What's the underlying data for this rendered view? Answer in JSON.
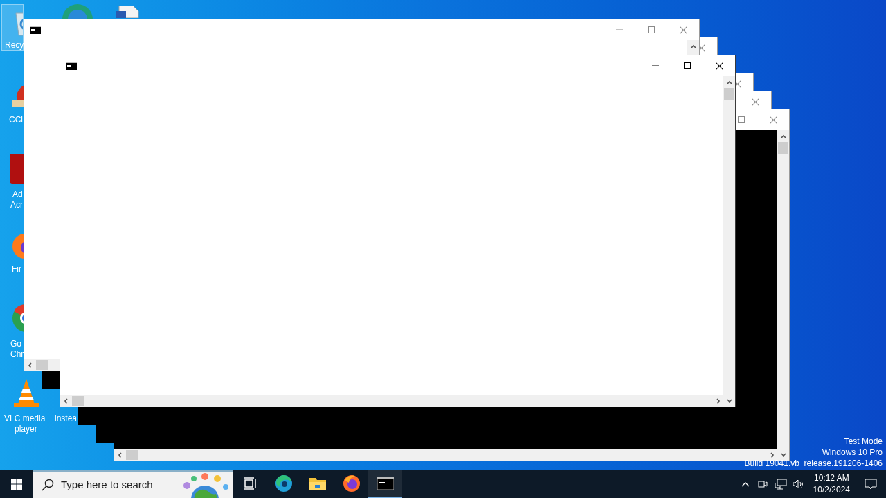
{
  "desktop": {
    "icons": [
      {
        "kind": "recycle-bin",
        "lines": [
          "Recy"
        ],
        "selected": true
      },
      {
        "kind": "browser-edge",
        "selected": false
      },
      {
        "kind": "document",
        "selected": false
      },
      {
        "kind": "cleaner",
        "lines": [
          "CCl"
        ],
        "selected": false
      },
      {
        "kind": "reader",
        "lines": [
          "Ad",
          "Acr"
        ],
        "selected": false
      },
      {
        "kind": "browser-fox",
        "lines": [
          "Fir"
        ],
        "selected": false
      },
      {
        "kind": "browser-chrome",
        "lines": [
          "Go",
          "Chr"
        ],
        "selected": false
      },
      {
        "kind": "cone",
        "lines": [
          "VLC media",
          "player"
        ],
        "selected": false
      },
      {
        "kind": "hidden",
        "lines": [
          "instea"
        ],
        "selected": false
      }
    ]
  },
  "windows": [
    {
      "kind": "dark",
      "active": false
    },
    {
      "kind": "dark",
      "active": false
    },
    {
      "kind": "dark",
      "active": false
    },
    {
      "kind": "dark",
      "active": false
    },
    {
      "kind": "light",
      "active": false
    },
    {
      "kind": "light",
      "active": true
    }
  ],
  "system_text": {
    "lines": [
      "Test Mode",
      "Windows 10 Pro",
      "Build 19041.vb_release.191206-1406"
    ]
  },
  "taskbar": {
    "search": {
      "placeholder": "Type here to search"
    },
    "apps": [
      {
        "kind": "task-view",
        "selected": false
      },
      {
        "kind": "edge",
        "selected": false
      },
      {
        "kind": "folder",
        "selected": false
      },
      {
        "kind": "fox",
        "selected": false
      },
      {
        "kind": "terminal",
        "selected": true
      }
    ],
    "clock": {
      "time": "10:12 AM",
      "date": "10/2/2024"
    }
  }
}
